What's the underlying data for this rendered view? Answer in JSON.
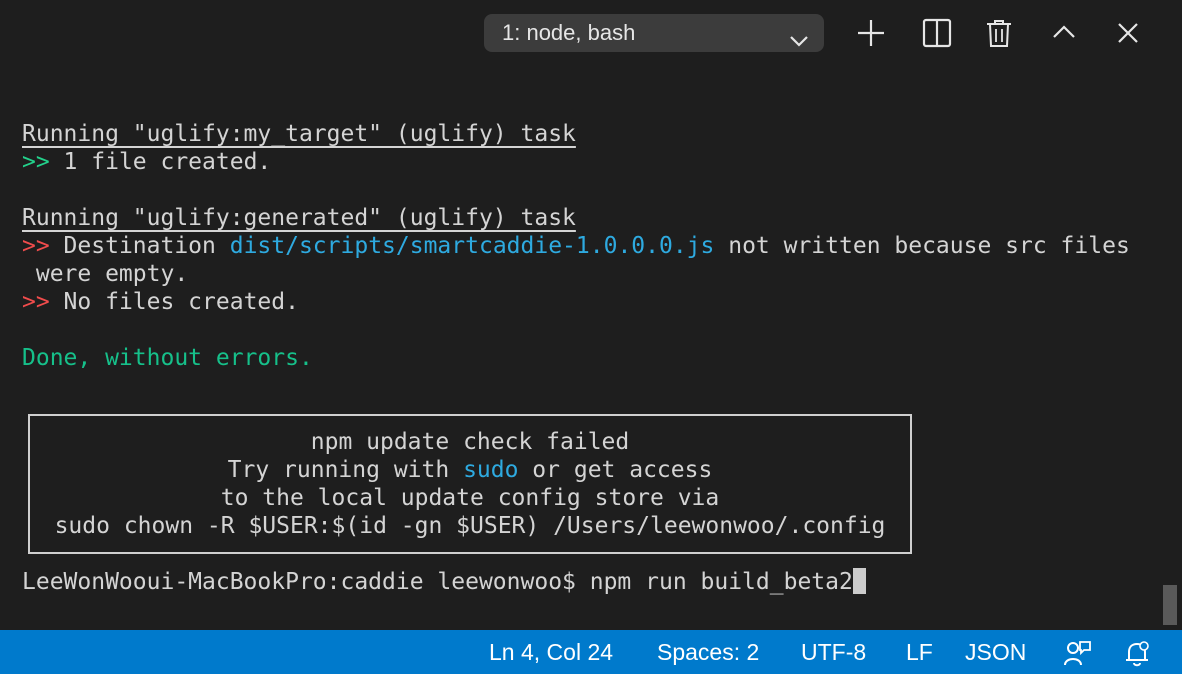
{
  "toolbar": {
    "terminal_select": "1: node, bash",
    "icons": [
      "plus-icon",
      "split-icon",
      "trash-icon",
      "chevron-up-icon",
      "close-icon"
    ]
  },
  "terminal": {
    "l1": "Running \"uglify:my_target\" (uglify) task",
    "l2_prompt": ">>",
    "l2_text": " 1 file created.",
    "l3": "Running \"uglify:generated\" (uglify) task",
    "l4_prompt": ">>",
    "l4_a": " Destination ",
    "l4_path": "dist/scripts/smartcaddie-1.0.0.0.js",
    "l4_b": " not written because src files",
    "l5": " were empty.",
    "l6_prompt": ">>",
    "l6_text": " No files created.",
    "done": "Done, without errors.",
    "box": {
      "title": "npm update check failed",
      "line2_a": "Try running with ",
      "line2_sudo": "sudo",
      "line2_b": " or get access",
      "line3": "to the local update config store via",
      "line4": "sudo chown -R $USER:$(id -gn $USER) /Users/leewonwoo/.config"
    },
    "prompt": "LeeWonWooui-MacBookPro:caddie leewonwoo$ npm run build_beta2"
  },
  "statusbar": {
    "position": "Ln 4, Col 24",
    "spaces": "Spaces: 2",
    "encoding": "UTF-8",
    "eol": "LF",
    "language": "JSON",
    "color": "#007acc"
  }
}
